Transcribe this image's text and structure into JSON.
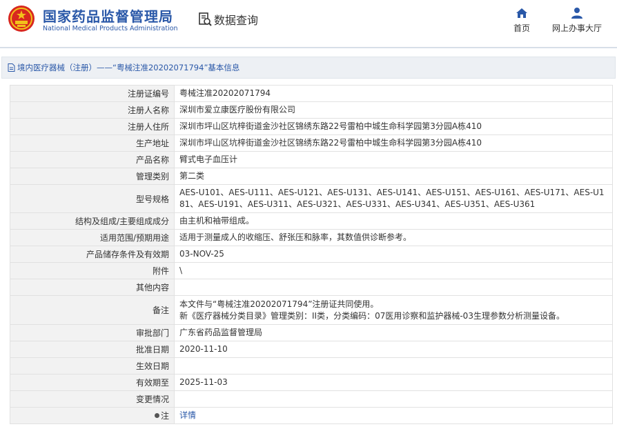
{
  "header": {
    "brand_cn": "国家药品监督管理局",
    "brand_en": "National Medical Products Administration",
    "module_label": "数据查询",
    "module_icon": "search-document-icon",
    "nav": [
      {
        "label": "首页",
        "icon": "home-icon"
      },
      {
        "label": "网上办事大厅",
        "icon": "user-icon"
      }
    ],
    "accent_color": "#2a58a8"
  },
  "breadcrumb": {
    "text": "境内医疗器械（注册）——“粤械注准20202071794”基本信息",
    "icon": "document-icon"
  },
  "rows": [
    {
      "label": "注册证编号",
      "value": "粤械注准20202071794"
    },
    {
      "label": "注册人名称",
      "value": "深圳市爱立康医疗股份有限公司"
    },
    {
      "label": "注册人住所",
      "value": "深圳市坪山区坑梓街道金沙社区锦绣东路22号雷柏中城生命科学园第3分园A栋410"
    },
    {
      "label": "生产地址",
      "value": "深圳市坪山区坑梓街道金沙社区锦绣东路22号雷柏中城生命科学园第3分园A栋410"
    },
    {
      "label": "产品名称",
      "value": "臂式电子血压计"
    },
    {
      "label": "管理类别",
      "value": "第二类"
    },
    {
      "label": "型号规格",
      "value": "AES-U101、AES-U111、AES-U121、AES-U131、AES-U141、AES-U151、AES-U161、AES-U171、AES-U181、AES-U191、AES-U311、AES-U321、AES-U331、AES-U341、AES-U351、AES-U361"
    },
    {
      "label": "结构及组成/主要组成成分",
      "value": "由主机和袖带组成。"
    },
    {
      "label": "适用范围/预期用途",
      "value": "适用于测量成人的收缩压、舒张压和脉率，其数值供诊断参考。"
    },
    {
      "label": "产品储存条件及有效期",
      "value": "03-NOV-25"
    },
    {
      "label": "附件",
      "value": "\\"
    },
    {
      "label": "其他内容",
      "value": ""
    },
    {
      "label": "备注",
      "value_line1": "本文件与“粤械注准20202071794”注册证共同使用。",
      "value_line2": "新《医疗器械分类目录》管理类别：II类，分类编码：07医用诊察和监护器械-03生理参数分析测量设备。"
    },
    {
      "label": "审批部门",
      "value": "广东省药品监督管理局"
    },
    {
      "label": "批准日期",
      "value": "2020-11-10"
    },
    {
      "label": "生效日期",
      "value": ""
    },
    {
      "label": "有效期至",
      "value": "2025-11-03"
    },
    {
      "label": "变更情况",
      "value": ""
    },
    {
      "label": "注",
      "label_icon": "pin-icon",
      "value": "详情"
    }
  ]
}
